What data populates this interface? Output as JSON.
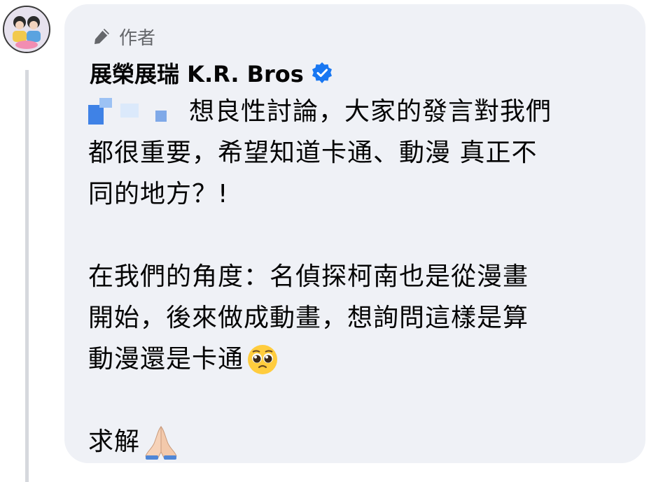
{
  "comment": {
    "badge_label": "作者",
    "author_name": "展榮展瑞 K.R. Bros",
    "text": {
      "line1": "想良性討論，大家的發言對我們",
      "line2": "都很重要，希望知道卡通、動漫 真正不",
      "line3": "同的地方？!",
      "line4": "在我們的角度：名偵探柯南也是從漫畫",
      "line5": "開始，後來做成動畫，想詢問這樣是算",
      "line6": "動漫還是卡通",
      "line7": "求解"
    },
    "emojis": {
      "pleading": "pleading-face",
      "pray": "folded-hands"
    },
    "icons": {
      "badge": "pencil-icon",
      "verified": "verified-badge-icon"
    }
  },
  "colors": {
    "bubble_bg": "#eff1f6",
    "verified_blue": "#1877f2",
    "meta_gray": "#65676b"
  }
}
